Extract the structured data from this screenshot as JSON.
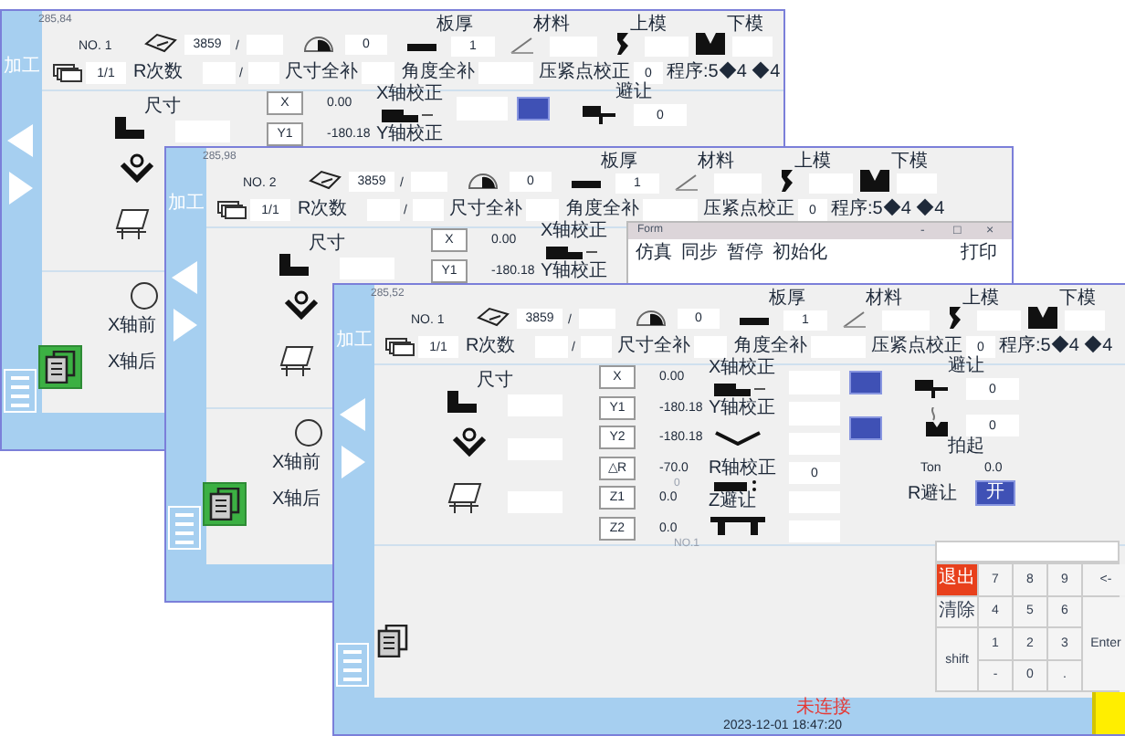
{
  "windows": [
    {
      "small_title": "285,84",
      "side_label": "加工",
      "doc_selected": true,
      "header": {
        "no": "NO. 1",
        "count": "3859",
        "count_separator": "/",
        "punch_value": "0",
        "thickness_label": "板厚",
        "thickness": "1",
        "material_label": "材料",
        "upper_label": "上模",
        "lower_label": "下模",
        "progress": "1/1",
        "r_label": "R次数",
        "r_separator": "/",
        "size_comp_label": "尺寸全补",
        "angle_comp_label": "角度全补",
        "clamp_label": "压紧点校正",
        "clamp_value": "0",
        "program": "程序:5◆4 ◆4"
      },
      "size_label": "尺寸",
      "axes": [
        {
          "label": "X",
          "value": "0.00"
        },
        {
          "label": "Y1",
          "value": "-180.18"
        }
      ],
      "corrections": [
        {
          "label": "X轴校正"
        },
        {
          "label": "Y轴校正"
        }
      ],
      "avoid": {
        "label": "避让",
        "value": "0"
      },
      "lower_labels": [
        "X轴前",
        "X轴后"
      ]
    },
    {
      "small_title": "285,98",
      "side_label": "加工",
      "doc_selected": true,
      "header": {
        "no": "NO. 2",
        "count": "3859",
        "count_separator": "/",
        "punch_value": "0",
        "thickness_label": "板厚",
        "thickness": "1",
        "material_label": "材料",
        "upper_label": "上模",
        "lower_label": "下模",
        "progress": "1/1",
        "r_label": "R次数",
        "r_separator": "/",
        "size_comp_label": "尺寸全补",
        "angle_comp_label": "角度全补",
        "clamp_label": "压紧点校正",
        "clamp_value": "0",
        "program": "程序:5◆4 ◆4"
      },
      "size_label": "尺寸",
      "axes": [
        {
          "label": "X",
          "value": "0.00"
        },
        {
          "label": "Y1",
          "value": "-180.18"
        }
      ],
      "corrections": [
        {
          "label": "X轴校正"
        },
        {
          "label": "Y轴校正"
        }
      ],
      "lower_labels": [
        "X轴前",
        "X轴后"
      ],
      "form": {
        "title": "Form",
        "controls": [
          "-",
          "□",
          "×"
        ],
        "menu": [
          "仿真",
          "同步",
          "暂停",
          "初始化"
        ],
        "menu_right": "打印"
      }
    },
    {
      "small_title": "285,52",
      "side_label": "加工",
      "doc_selected": false,
      "header": {
        "no": "NO. 1",
        "count": "3859",
        "count_separator": "/",
        "punch_value": "0",
        "thickness_label": "板厚",
        "thickness": "1",
        "material_label": "材料",
        "upper_label": "上模",
        "lower_label": "下模",
        "progress": "1/1",
        "r_label": "R次数",
        "r_separator": "/",
        "size_comp_label": "尺寸全补",
        "angle_comp_label": "角度全补",
        "clamp_label": "压紧点校正",
        "clamp_value": "0",
        "program": "程序:5◆4 ◆4"
      },
      "size_label": "尺寸",
      "axes": [
        {
          "label": "X",
          "value": "0.00"
        },
        {
          "label": "Y1",
          "value": "-180.18"
        },
        {
          "label": "Y2",
          "value": "-180.18"
        },
        {
          "label": "△R",
          "value": "-70.0",
          "note": "0"
        },
        {
          "label": "Z1",
          "value": "0.0"
        },
        {
          "label": "Z2",
          "value": "0.0",
          "note": "NO.1"
        }
      ],
      "corrections": [
        {
          "label": "X轴校正"
        },
        {
          "label": "Y轴校正"
        },
        {
          "label": "R轴校正",
          "value": "0"
        },
        {
          "label": "Z避让"
        }
      ],
      "avoid": {
        "label": "避让",
        "value": "0"
      },
      "lift": {
        "label": "拍起",
        "value": "0"
      },
      "ton": {
        "label": "Ton",
        "value": "0.0"
      },
      "r_avoid": {
        "label": "R避让",
        "button": "开"
      },
      "status": "未连接",
      "datetime": "2023-12-01 18:47:20",
      "keypad": [
        {
          "label": "退出",
          "kind": "danger"
        },
        {
          "label": "7",
          "kind": "key"
        },
        {
          "label": "8",
          "kind": "key"
        },
        {
          "label": "9",
          "kind": "key"
        },
        {
          "label": "<-",
          "kind": "key"
        },
        {
          "label": "清除",
          "kind": "key"
        },
        {
          "label": "4",
          "kind": "key"
        },
        {
          "label": "5",
          "kind": "key"
        },
        {
          "label": "6",
          "kind": "key"
        },
        {
          "label": "Enter",
          "kind": "key"
        },
        {
          "label": "shift",
          "kind": "key"
        },
        {
          "label": "1",
          "kind": "key"
        },
        {
          "label": "2",
          "kind": "key"
        },
        {
          "label": "3",
          "kind": "key"
        },
        {
          "label": "-",
          "kind": "key"
        },
        {
          "label": "0",
          "kind": "key"
        },
        {
          "label": ".",
          "kind": "key"
        }
      ]
    }
  ]
}
